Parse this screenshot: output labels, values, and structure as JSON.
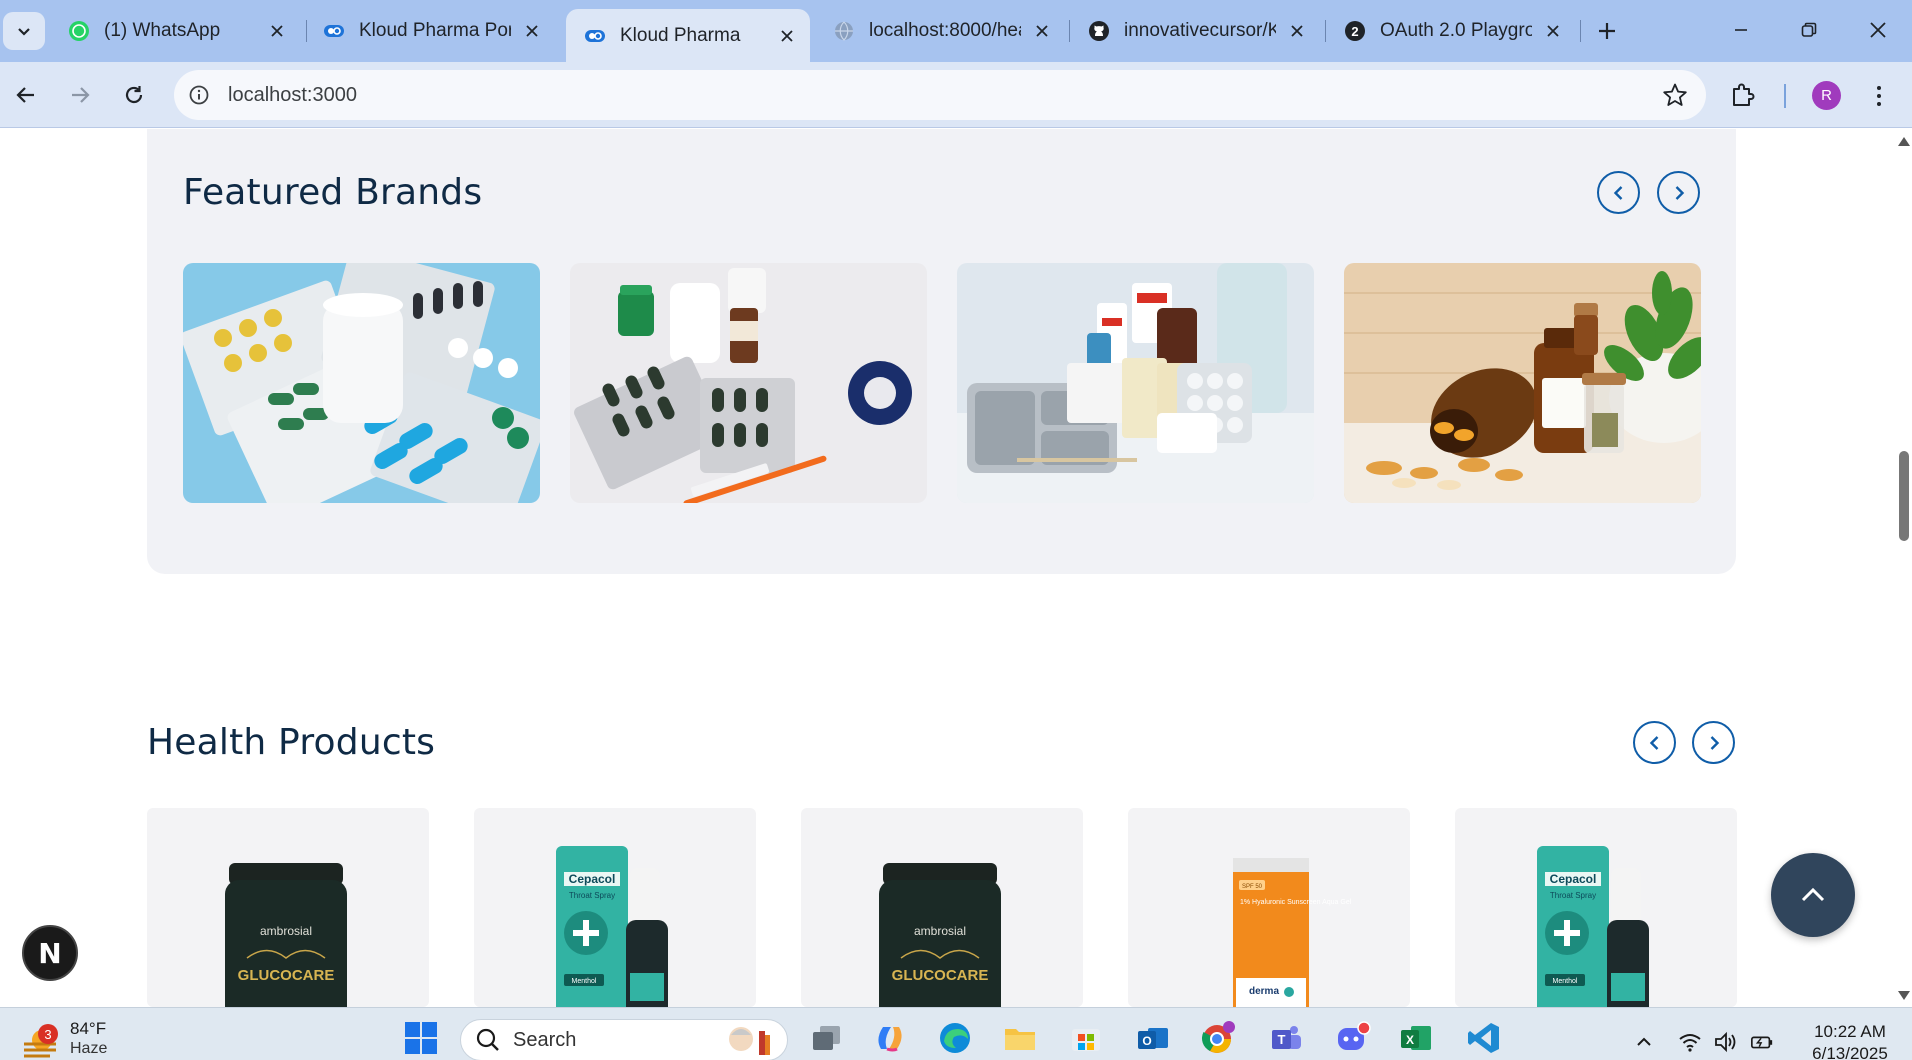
{
  "browser": {
    "tabs": [
      {
        "title": "(1) WhatsApp",
        "icon": "whatsapp-icon"
      },
      {
        "title": "Kloud Pharma Port",
        "icon": "kloud-logo-icon"
      },
      {
        "title": "Kloud Pharma",
        "icon": "kloud-logo-icon",
        "active": true
      },
      {
        "title": "localhost:8000/hea",
        "icon": "globe-icon"
      },
      {
        "title": "innovativecursor/K",
        "icon": "github-icon"
      },
      {
        "title": "OAuth 2.0 Playgro",
        "icon": "oauth-icon"
      }
    ],
    "url": "localhost:3000",
    "profile_initial": "R"
  },
  "page": {
    "featured_brands": {
      "title": "Featured Brands",
      "images": [
        "pills-blister-packs",
        "capsules-syringe-tape",
        "first-aid-supplies",
        "herbal-medicine-bottles"
      ]
    },
    "health_products": {
      "title": "Health Products",
      "products": [
        {
          "brand": "ambrosial",
          "name": "GLUCOCARE"
        },
        {
          "brand": "Cepacol",
          "name": "Throat Spray",
          "variant": "Menthol"
        },
        {
          "brand": "ambrosial",
          "name": "GLUCOCARE"
        },
        {
          "brand": "derma",
          "name": "1% Hyaluronic Sunscreen Aqua Gel",
          "spf": "SPF 50"
        },
        {
          "brand": "Cepacol",
          "name": "Throat Spray",
          "variant": "Menthol"
        }
      ]
    },
    "next_badge": "N"
  },
  "taskbar": {
    "weather": {
      "temp": "84°F",
      "condition": "Haze",
      "badge": "3"
    },
    "search_label": "Search",
    "clock_time": "10:22 AM",
    "clock_date": "6/13/2025"
  },
  "colors": {
    "tabstrip": "#a7c3ef",
    "toolbar": "#dce6f6",
    "heading": "#0f2a45",
    "arrow_accent": "#0f5da8",
    "back_to_top": "#30455c"
  }
}
